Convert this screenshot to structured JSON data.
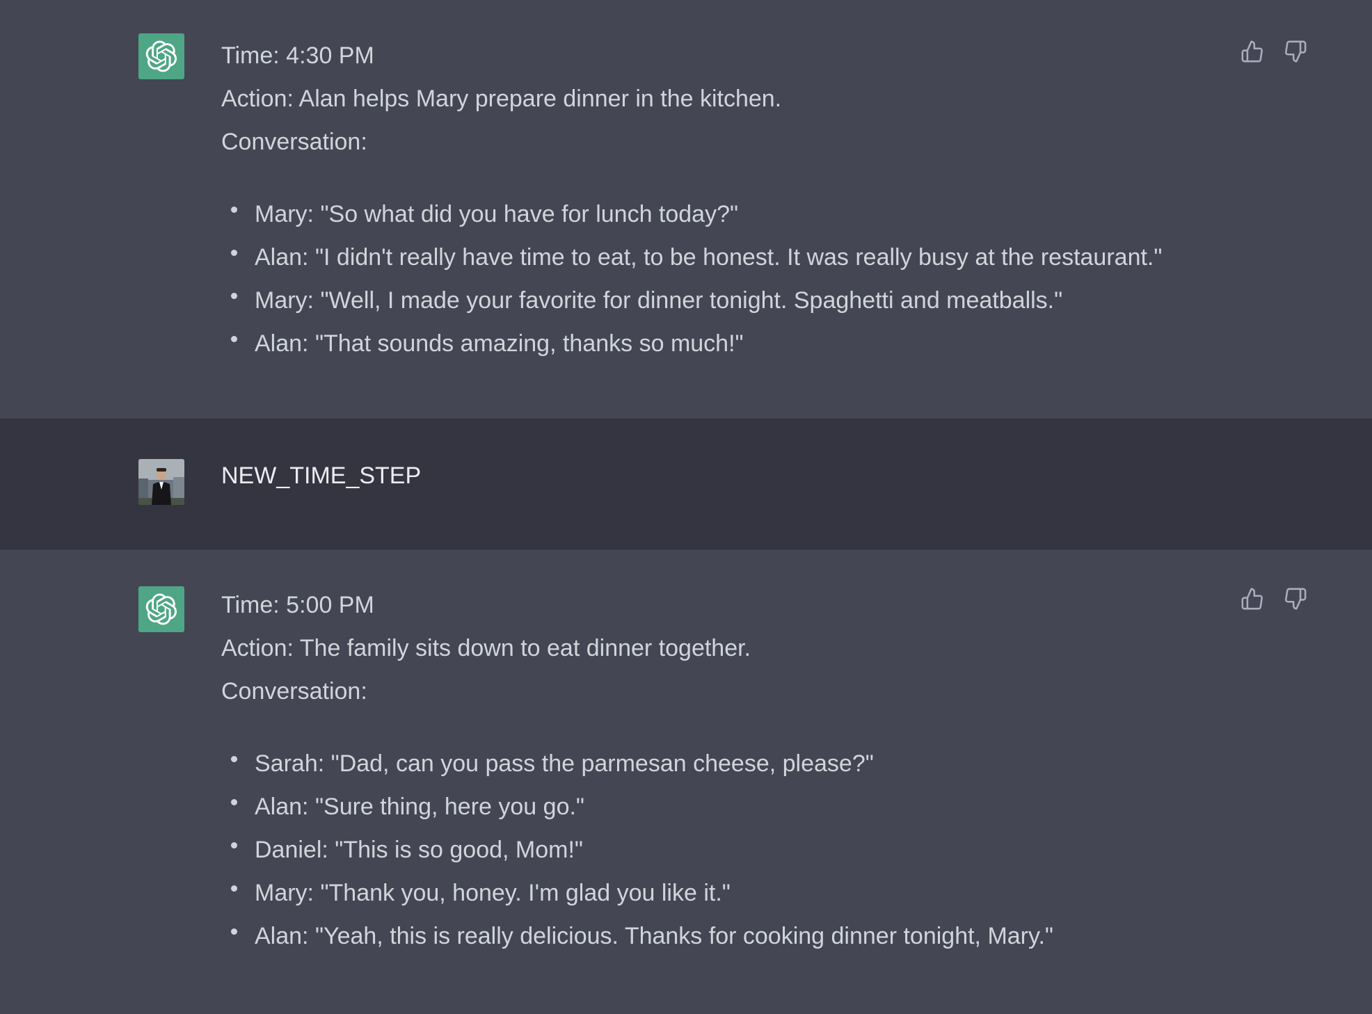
{
  "messages": [
    {
      "role": "assistant",
      "time": "Time: 4:30 PM",
      "action": "Action: Alan helps Mary prepare dinner in the kitchen.",
      "conversation_label": "Conversation:",
      "lines": [
        "Mary: \"So what did you have for lunch today?\"",
        "Alan: \"I didn't really have time to eat, to be honest. It was really busy at the restaurant.\"",
        "Mary: \"Well, I made your favorite for dinner tonight. Spaghetti and meatballs.\"",
        "Alan: \"That sounds amazing, thanks so much!\""
      ]
    },
    {
      "role": "user",
      "text": "NEW_TIME_STEP"
    },
    {
      "role": "assistant",
      "time": "Time: 5:00 PM",
      "action": "Action: The family sits down to eat dinner together.",
      "conversation_label": "Conversation:",
      "lines": [
        "Sarah: \"Dad, can you pass the parmesan cheese, please?\"",
        "Alan: \"Sure thing, here you go.\"",
        "Daniel: \"This is so good, Mom!\"",
        "Mary: \"Thank you, honey. I'm glad you like it.\"",
        "Alan: \"Yeah, this is really delicious. Thanks for cooking dinner tonight, Mary.\""
      ]
    }
  ],
  "icons": {
    "assistant_avatar": "openai-logo-icon",
    "user_avatar": "user-photo-avatar",
    "thumbs_up": "thumbs-up-icon",
    "thumbs_down": "thumbs-down-icon"
  },
  "colors": {
    "assistant_bg": "#444654",
    "user_bg": "#343541",
    "text": "#d1d5db",
    "bot_avatar_bg": "#4ea686"
  }
}
